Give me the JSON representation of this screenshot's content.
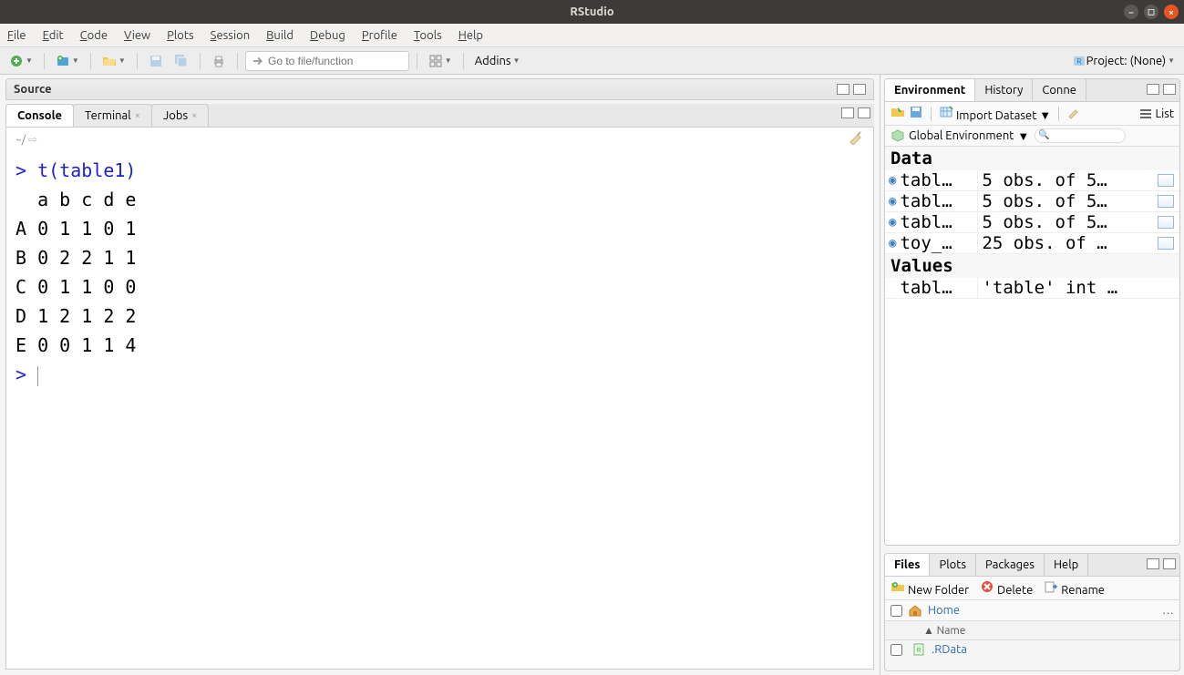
{
  "window": {
    "title": "RStudio"
  },
  "menu": {
    "file": "File",
    "edit": "Edit",
    "code": "Code",
    "view": "View",
    "plots": "Plots",
    "session": "Session",
    "build": "Build",
    "debug": "Debug",
    "profile": "Profile",
    "tools": "Tools",
    "help": "Help"
  },
  "toolbar": {
    "goto_placeholder": "Go to file/function",
    "addins_label": "Addins",
    "project_label": "Project: (None)"
  },
  "source_pane": {
    "title": "Source"
  },
  "console_tabs": {
    "console": "Console",
    "terminal": "Terminal",
    "jobs": "Jobs"
  },
  "console": {
    "path": "~/",
    "command": "t(table1)",
    "output": "  a b c d e\nA 0 1 1 0 1\nB 0 2 2 1 1\nC 0 1 1 0 0\nD 1 2 1 2 2\nE 0 0 1 1 4"
  },
  "env_tabs": {
    "environment": "Environment",
    "history": "History",
    "connections": "Conne"
  },
  "env_toolbar": {
    "import": "Import Dataset",
    "list": "List"
  },
  "env_scope": {
    "label": "Global Environment"
  },
  "env": {
    "data_header": "Data",
    "values_header": "Values",
    "rows": [
      {
        "name": "tabl…",
        "val": "5 obs. of 5…",
        "grid": true
      },
      {
        "name": "tabl…",
        "val": "5 obs. of 5…",
        "grid": true
      },
      {
        "name": "tabl…",
        "val": "5 obs. of 5…",
        "grid": true
      },
      {
        "name": "toy_…",
        "val": "25 obs. of …",
        "grid": true
      }
    ],
    "values": [
      {
        "name": "tabl…",
        "val": "'table' int …"
      }
    ]
  },
  "files_tabs": {
    "files": "Files",
    "plots": "Plots",
    "packages": "Packages",
    "help": "Help"
  },
  "files_toolbar": {
    "newfolder": "New Folder",
    "delete": "Delete",
    "rename": "Rename"
  },
  "files": {
    "breadcrumb": "Home",
    "name_header": "Name",
    "row0": ".RData"
  }
}
